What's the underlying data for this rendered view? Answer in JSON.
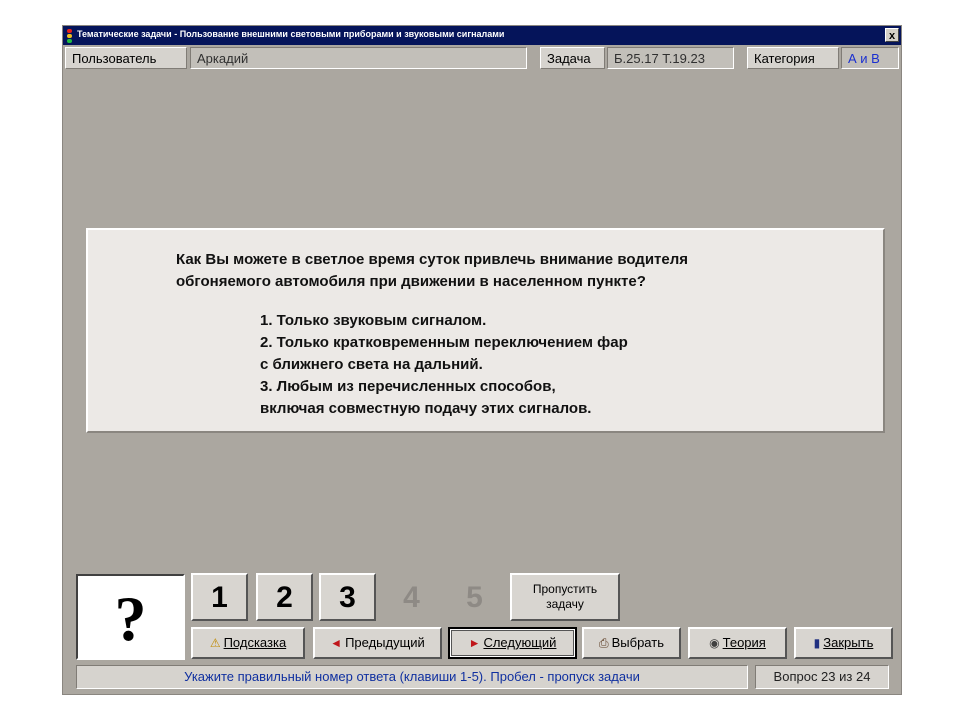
{
  "window": {
    "title": "Тематические задачи - Пользование внешними световыми приборами и звуковыми сигналами",
    "close_label": "x"
  },
  "infobar": {
    "user_label": "Пользователь",
    "user_value": "Аркадий",
    "task_label": "Задача",
    "task_value": "Б.25.17  Т.19.23",
    "category_label": "Категория",
    "category_value": "А и В"
  },
  "question": {
    "text": "Как Вы можете в светлое время суток привлечь внимание водителя\nобгоняемого автомобиля при движении в населенном пункте?",
    "answers": [
      "1. Только звуковым сигналом.",
      "2. Только кратковременным переключением фар\n    с ближнего света на дальний.",
      "3. Любым из перечисленных способов,\n    включая совместную подачу этих сигналов."
    ]
  },
  "answer_indicator": "?",
  "number_buttons": [
    "1",
    "2",
    "3",
    "4",
    "5"
  ],
  "skip_button": "Пропустить\nзадачу",
  "action_buttons": {
    "hint": "Подсказка",
    "prev": "Предыдущий",
    "next": "Следующий",
    "choose": "Выбрать",
    "theory": "Теория",
    "close": "Закрыть"
  },
  "status": {
    "message": "Укажите правильный номер ответа (клавиши 1-5). Пробел - пропуск задачи",
    "counter": "Вопрос 23 из 24"
  },
  "colors": {
    "titlebar": "#05145a",
    "window_bg": "#aba7a0",
    "panel_bg": "#ece9e6",
    "status_text": "#1030a0",
    "accent_red": "#c0161a",
    "category_blue": "#1a2fd0"
  },
  "icons": {
    "app": "traffic-light-icon",
    "hint": "warning-triangle-icon",
    "prev": "arrow-left-icon",
    "next": "arrow-right-icon",
    "choose": "printer-icon",
    "theory": "eye-icon",
    "close": "exit-door-icon"
  }
}
